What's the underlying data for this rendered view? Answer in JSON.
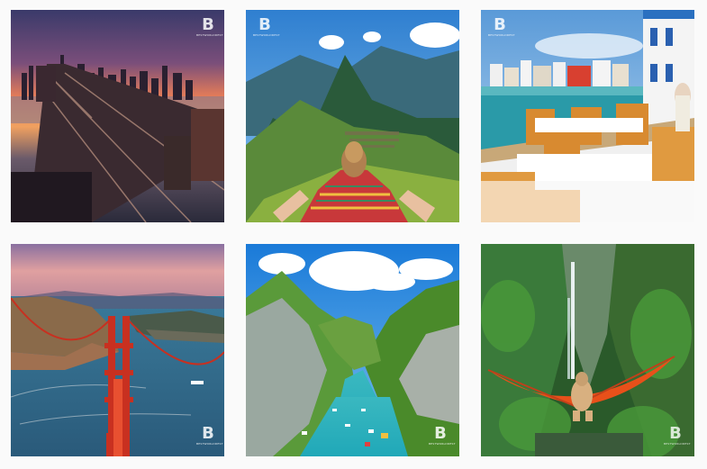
{
  "gallery": {
    "watermark_letter": "B",
    "watermark_brand": "BESTWORLDDEST",
    "posts": [
      {
        "subject": "New York skyline with Brooklyn Bridge at sunset"
      },
      {
        "subject": "Machu Picchu with woman in striped poncho"
      },
      {
        "subject": "Little Venice seaside cafe, Mykonos"
      },
      {
        "subject": "Golden Gate Bridge aerial view"
      },
      {
        "subject": "Verdon Gorge turquoise river with boats"
      },
      {
        "subject": "Waterfall canyon with orange hammock"
      }
    ]
  }
}
